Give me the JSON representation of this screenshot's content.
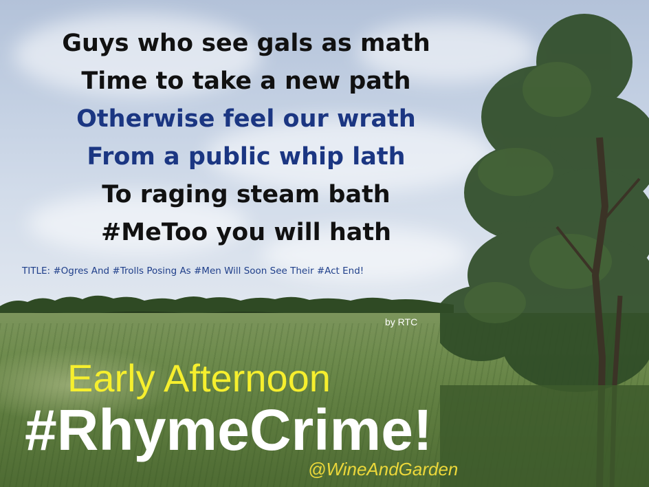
{
  "poem": {
    "lines": [
      "Guys who see gals as math",
      "Time to take a new path",
      "Otherwise feel our wrath",
      "From a public whip lath",
      "To raging steam bath",
      "#MeToo you will hath"
    ]
  },
  "title_line": "TITLE: #Ogres And #Trolls Posing As #Men Will Soon See Their #Act End!",
  "byline": "by RTC",
  "banner": {
    "subtitle": "Early Afternoon",
    "headline": "#RhymeCrime!",
    "handle": "@WineAndGarden"
  },
  "colors": {
    "poem_black": "#111111",
    "poem_blue": "#1b3682",
    "subtitle_yellow": "#f6ef2e",
    "headline_white": "#ffffff",
    "handle_yellow": "#ecd83a"
  }
}
